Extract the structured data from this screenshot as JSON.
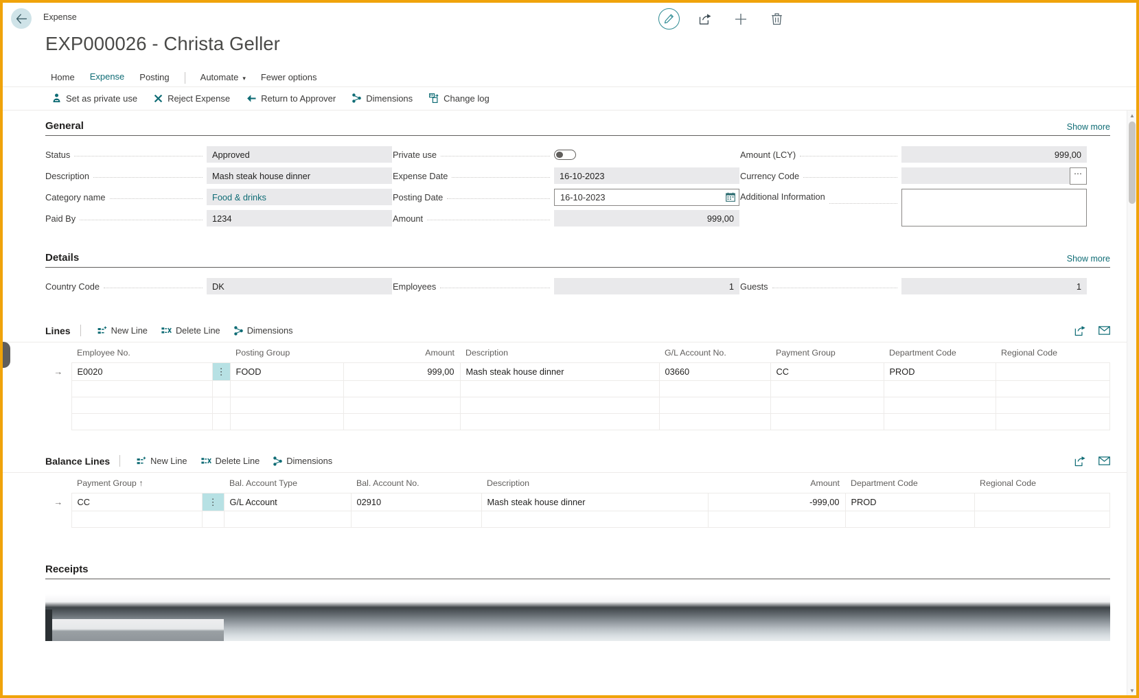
{
  "window": {
    "breadcrumb": "Expense",
    "page_title": "EXP000026 - Christa Geller",
    "accent_color": "#0f6c75",
    "highlight_frame_color": "#f0a30a"
  },
  "topbar": {
    "back_icon": "arrow-left-icon",
    "actions": [
      {
        "name": "edit-button",
        "icon": "pencil-icon"
      },
      {
        "name": "share-button",
        "icon": "share-icon"
      },
      {
        "name": "new-button",
        "icon": "plus-icon"
      },
      {
        "name": "delete-button",
        "icon": "trash-icon"
      }
    ]
  },
  "nav": {
    "items": [
      {
        "label": "Home",
        "active": false
      },
      {
        "label": "Expense",
        "active": true
      },
      {
        "label": "Posting",
        "active": false
      }
    ],
    "automate": "Automate",
    "fewer_options": "Fewer options"
  },
  "ribbon": {
    "buttons": [
      {
        "label": "Set as private use",
        "icon": "private-use-icon"
      },
      {
        "label": "Reject Expense",
        "icon": "x-icon"
      },
      {
        "label": "Return to Approver",
        "icon": "arrow-left-icon"
      },
      {
        "label": "Dimensions",
        "icon": "dimensions-icon"
      },
      {
        "label": "Change log",
        "icon": "change-log-icon"
      }
    ]
  },
  "general": {
    "title": "General",
    "show_more": "Show more",
    "col1": [
      {
        "label": "Status",
        "value": "Approved",
        "style": "readonly"
      },
      {
        "label": "Description",
        "value": "Mash steak house dinner",
        "style": "readonly"
      },
      {
        "label": "Category name",
        "value": "Food & drinks",
        "style": "link"
      },
      {
        "label": "Paid By",
        "value": "1234",
        "style": "readonly"
      }
    ],
    "col2": [
      {
        "label": "Private use",
        "value": "",
        "style": "toggle",
        "toggle_on": false
      },
      {
        "label": "Expense Date",
        "value": "16-10-2023",
        "style": "readonly"
      },
      {
        "label": "Posting Date",
        "value": "16-10-2023",
        "style": "date"
      },
      {
        "label": "Amount",
        "value": "999,00",
        "style": "readonly-num"
      }
    ],
    "col3": [
      {
        "label": "Amount (LCY)",
        "value": "999,00",
        "style": "readonly-num"
      },
      {
        "label": "Currency Code",
        "value": "",
        "style": "assist"
      },
      {
        "label": "Additional Information",
        "value": "",
        "style": "textarea"
      }
    ]
  },
  "details": {
    "title": "Details",
    "show_more": "Show more",
    "fields": [
      {
        "label": "Country Code",
        "value": "DK",
        "style": "readonly"
      },
      {
        "label": "Employees",
        "value": "1",
        "style": "readonly-num"
      },
      {
        "label": "Guests",
        "value": "1",
        "style": "readonly-num"
      }
    ]
  },
  "lines": {
    "title": "Lines",
    "buttons": [
      {
        "label": "New Line",
        "icon": "new-line-icon"
      },
      {
        "label": "Delete Line",
        "icon": "delete-line-icon"
      },
      {
        "label": "Dimensions",
        "icon": "dimensions-icon"
      }
    ],
    "right_icons": [
      {
        "name": "open-in-excel-icon"
      },
      {
        "name": "share-grid-icon"
      }
    ],
    "columns": [
      "Employee No.",
      "Posting Group",
      "Amount",
      "Description",
      "G/L Account No.",
      "Payment Group",
      "Department Code",
      "Regional Code"
    ],
    "rows": [
      {
        "selected": true,
        "employee_no": "E0020",
        "posting_group": "FOOD",
        "amount": "999,00",
        "description": "Mash steak house dinner",
        "gl_account_no": "03660",
        "payment_group": "CC",
        "department_code": "PROD",
        "regional_code": ""
      }
    ],
    "empty_row_count": 3
  },
  "balance_lines": {
    "title": "Balance Lines",
    "buttons": [
      {
        "label": "New Line",
        "icon": "new-line-icon"
      },
      {
        "label": "Delete Line",
        "icon": "delete-line-icon"
      },
      {
        "label": "Dimensions",
        "icon": "dimensions-icon"
      }
    ],
    "right_icons": [
      {
        "name": "open-in-excel-icon"
      },
      {
        "name": "share-grid-icon"
      }
    ],
    "columns": [
      "Payment Group ↑",
      "Bal. Account Type",
      "Bal. Account No.",
      "Description",
      "Amount",
      "Department Code",
      "Regional Code"
    ],
    "rows": [
      {
        "selected": true,
        "payment_group": "CC",
        "bal_account_type": "G/L Account",
        "bal_account_no": "02910",
        "description": "Mash steak house dinner",
        "amount": "-999,00",
        "department_code": "PROD",
        "regional_code": ""
      }
    ],
    "empty_row_count": 1
  },
  "receipts": {
    "title": "Receipts"
  }
}
